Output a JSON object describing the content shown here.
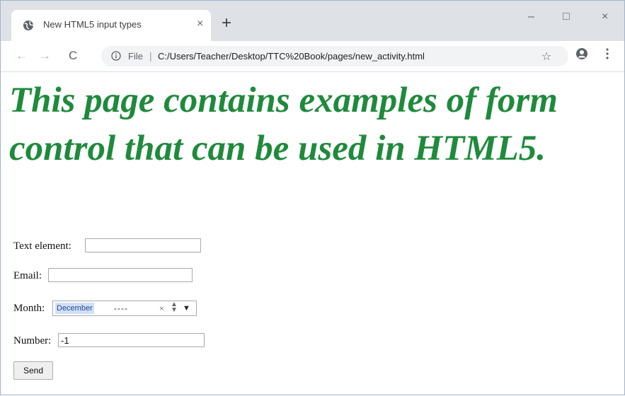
{
  "browser": {
    "tab": {
      "title": "New HTML5 input types",
      "close_glyph": "×"
    },
    "new_tab_glyph": "+",
    "window_controls": {
      "minimize": "–",
      "maximize": "□",
      "close": "×"
    },
    "nav": {
      "back": "←",
      "forward": "→",
      "reload": "C"
    },
    "address": {
      "scheme_label": "File",
      "separator": "|",
      "url": "C:/Users/Teacher/Desktop/TTC%20Book/pages/new_activity.html"
    },
    "bookmark_glyph": "☆"
  },
  "page": {
    "heading": "This page contains examples of form control that can be used in HTML5.",
    "form": {
      "text_label": "Text element:",
      "text_value": "",
      "email_label": "Email:",
      "email_value": "",
      "month_label": "Month:",
      "month_value": "December",
      "month_year": "----",
      "month_clear": "×",
      "month_spin": "▲▼",
      "month_dropdown": "▼",
      "number_label": "Number:",
      "number_value": "-1",
      "send_label": "Send"
    }
  },
  "colors": {
    "heading": "#1f8a3c",
    "tabstrip": "#dee1e6",
    "month_highlight": "#cfe0fb"
  }
}
